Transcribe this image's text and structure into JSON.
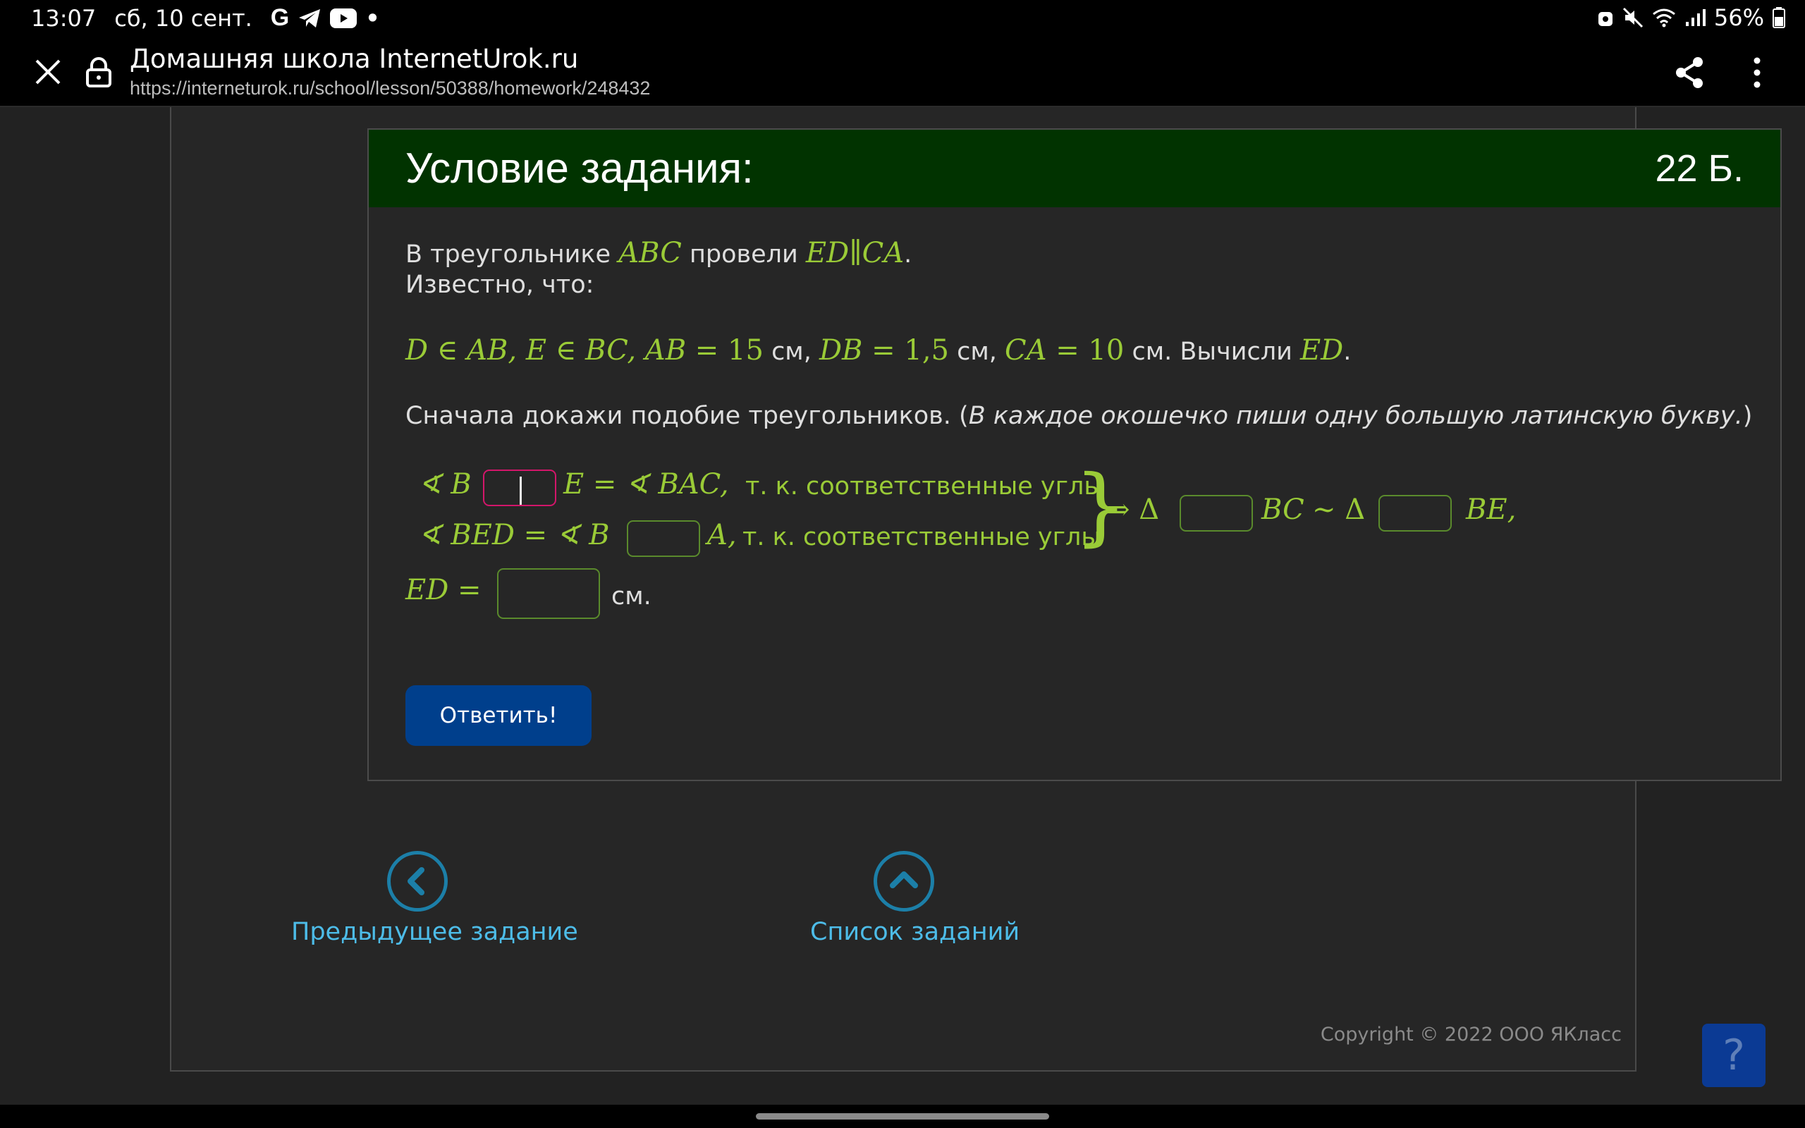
{
  "status_bar": {
    "time": "13:07",
    "date": "сб, 10 сент.",
    "battery": "56%",
    "notif_dot": "•",
    "notif_icons": [
      "google-icon",
      "telegram-icon",
      "youtube-icon"
    ]
  },
  "browser": {
    "title": "Домашняя школа InternetUrok.ru",
    "url": "https://interneturok.ru/school/lesson/50388/homework/248432"
  },
  "task": {
    "heading": "Условие задания:",
    "points": "22 Б.",
    "p1_pre": "В треугольнике ",
    "p1_abc": "ABC",
    "p1_mid": " провели ",
    "p1_ed": "ED",
    "p1_par": "∥",
    "p1_ca": "CA",
    "p1_end": ".",
    "p2": "Известно, что:",
    "cond": {
      "d_in_ab": "D ∈ AB, E ∈ BC, AB",
      "eq1": " = 15",
      "unit1": " см, ",
      "db": "DB",
      "eq2": " = 1,5",
      "unit2": " см, ",
      "ca": "CA",
      "eq3": " = 10",
      "unit3": " см. Вычисли ",
      "ed": "ED",
      "end": "."
    },
    "instruction_pre": "Сначала докажи подобие треугольников. (",
    "instruction_it": "В каждое окошечко пиши одну большую латинскую букву.",
    "instruction_post": ")",
    "row1": {
      "a": "∢ B",
      "b": "E = ∢ BAC,",
      "reason": "т. к.  соответственные углы"
    },
    "row2": {
      "a": "∢ BED = ∢ B",
      "b": "A,",
      "reason": "т. к.  соответственные углы"
    },
    "brace": "}",
    "impl": "⇒ Δ",
    "bc": "BC",
    "sim": "∼ Δ",
    "be": "BE,",
    "ed_label": "ED =",
    "ed_unit": "см.",
    "answer_label": "Ответить!"
  },
  "nav": {
    "prev_label": "Предыдущее задание",
    "list_label": "Список заданий"
  },
  "copyright": "Copyright © 2022 ООО ЯКласс",
  "help_label": "?",
  "colors": {
    "header_green": "#013300",
    "math_green": "#9acb37",
    "button_blue": "#003f8c",
    "link_blue": "#4dbce8",
    "active_box": "#d3166a",
    "chat_red": "#9c0000"
  }
}
